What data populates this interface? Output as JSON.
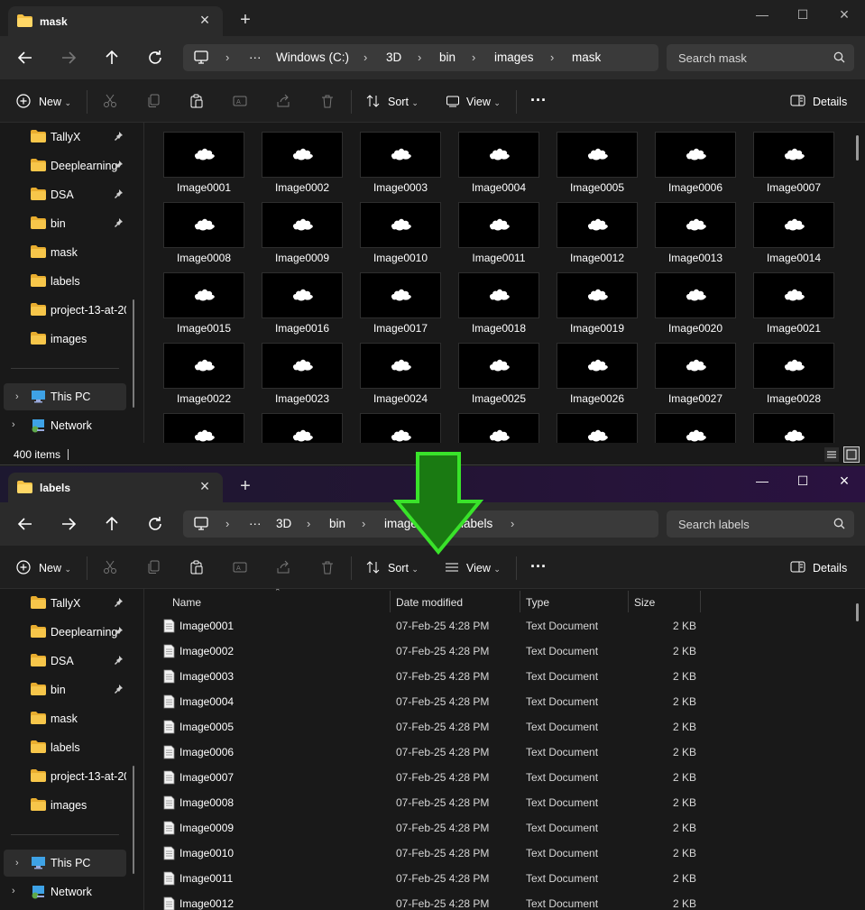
{
  "window_top": {
    "tab_title": "mask",
    "breadcrumbs": [
      "Windows (C:)",
      "3D",
      "bin",
      "images",
      "mask"
    ],
    "search_placeholder": "Search mask",
    "commands": {
      "new": "New",
      "sort": "Sort",
      "view": "View",
      "details": "Details"
    },
    "sidebar": [
      {
        "label": "TallyX",
        "pinned": true
      },
      {
        "label": "Deeplearning",
        "pinned": true
      },
      {
        "label": "DSA",
        "pinned": true
      },
      {
        "label": "bin",
        "pinned": true
      },
      {
        "label": "mask",
        "pinned": false
      },
      {
        "label": "labels",
        "pinned": false
      },
      {
        "label": "project-13-at-20",
        "pinned": false
      },
      {
        "label": "images",
        "pinned": false
      }
    ],
    "sidebar_bottom": {
      "this_pc": "This PC",
      "network": "Network"
    },
    "thumbnails": [
      "Image0001",
      "Image0002",
      "Image0003",
      "Image0004",
      "Image0005",
      "Image0006",
      "Image0007",
      "Image0008",
      "Image0009",
      "Image0010",
      "Image0011",
      "Image0012",
      "Image0013",
      "Image0014",
      "Image0015",
      "Image0016",
      "Image0017",
      "Image0018",
      "Image0019",
      "Image0020",
      "Image0021",
      "Image0022",
      "Image0023",
      "Image0024",
      "Image0025",
      "Image0026",
      "Image0027",
      "Image0028"
    ],
    "status": "400 items"
  },
  "window_bottom": {
    "tab_title": "labels",
    "breadcrumbs": [
      "3D",
      "bin",
      "images",
      "labels"
    ],
    "search_placeholder": "Search labels",
    "commands": {
      "new": "New",
      "sort": "Sort",
      "view": "View",
      "details": "Details"
    },
    "sidebar": [
      {
        "label": "TallyX",
        "pinned": true
      },
      {
        "label": "Deeplearning",
        "pinned": true
      },
      {
        "label": "DSA",
        "pinned": true
      },
      {
        "label": "bin",
        "pinned": true
      },
      {
        "label": "mask",
        "pinned": false
      },
      {
        "label": "labels",
        "pinned": false
      },
      {
        "label": "project-13-at-20",
        "pinned": false
      },
      {
        "label": "images",
        "pinned": false
      }
    ],
    "sidebar_bottom": {
      "this_pc": "This PC",
      "network": "Network"
    },
    "columns": {
      "name": "Name",
      "date": "Date modified",
      "type": "Type",
      "size": "Size"
    },
    "files": [
      {
        "name": "Image0001",
        "date": "07-Feb-25 4:28 PM",
        "type": "Text Document",
        "size": "2 KB"
      },
      {
        "name": "Image0002",
        "date": "07-Feb-25 4:28 PM",
        "type": "Text Document",
        "size": "2 KB"
      },
      {
        "name": "Image0003",
        "date": "07-Feb-25 4:28 PM",
        "type": "Text Document",
        "size": "2 KB"
      },
      {
        "name": "Image0004",
        "date": "07-Feb-25 4:28 PM",
        "type": "Text Document",
        "size": "2 KB"
      },
      {
        "name": "Image0005",
        "date": "07-Feb-25 4:28 PM",
        "type": "Text Document",
        "size": "2 KB"
      },
      {
        "name": "Image0006",
        "date": "07-Feb-25 4:28 PM",
        "type": "Text Document",
        "size": "2 KB"
      },
      {
        "name": "Image0007",
        "date": "07-Feb-25 4:28 PM",
        "type": "Text Document",
        "size": "2 KB"
      },
      {
        "name": "Image0008",
        "date": "07-Feb-25 4:28 PM",
        "type": "Text Document",
        "size": "2 KB"
      },
      {
        "name": "Image0009",
        "date": "07-Feb-25 4:28 PM",
        "type": "Text Document",
        "size": "2 KB"
      },
      {
        "name": "Image0010",
        "date": "07-Feb-25 4:28 PM",
        "type": "Text Document",
        "size": "2 KB"
      },
      {
        "name": "Image0011",
        "date": "07-Feb-25 4:28 PM",
        "type": "Text Document",
        "size": "2 KB"
      },
      {
        "name": "Image0012",
        "date": "07-Feb-25 4:28 PM",
        "type": "Text Document",
        "size": "2 KB"
      }
    ]
  },
  "colors": {
    "folder": "#f5c144",
    "arrow_fill": "#1a7a12",
    "arrow_stroke": "#39e32a",
    "accent": "#4ea4ff"
  }
}
